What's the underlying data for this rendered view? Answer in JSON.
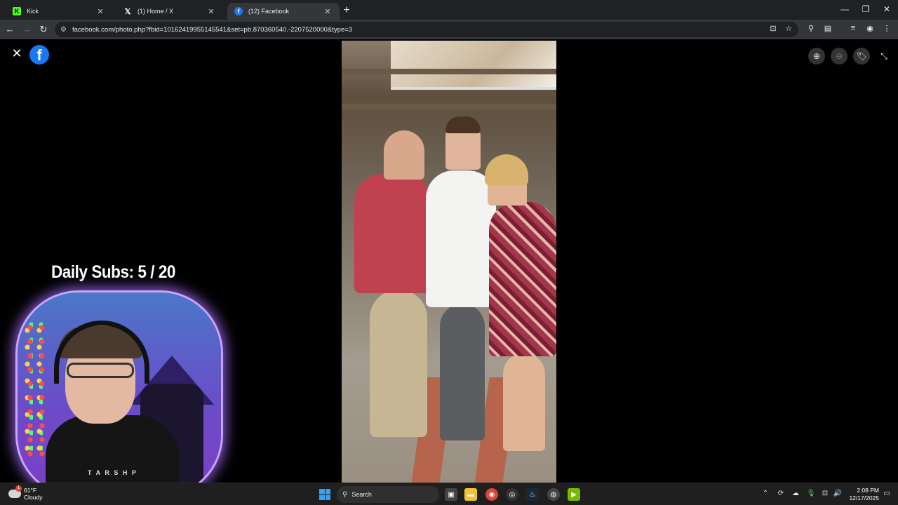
{
  "browser": {
    "tabs": [
      {
        "label": "Kick",
        "favicon": "kick-icon"
      },
      {
        "label": "(1) Home / X",
        "favicon": "x-icon"
      },
      {
        "label": "(12) Facebook",
        "favicon": "facebook-icon",
        "active": true
      }
    ],
    "url": "facebook.com/photo.php?fbid=10162419955145541&set=pb.870360540.-2207520000&type=3"
  },
  "viewer": {
    "close_glyph": "✕",
    "logo_letter": "f",
    "photo_alt": "Three people posing at a graduation ceremony"
  },
  "overlay": {
    "daily_subs": "Daily Subs:  5 / 20",
    "hoodie_text": "T A R S H  P"
  },
  "taskbar": {
    "weather_temp": "61°F",
    "weather_cond": "Cloudy",
    "search_label": "Search",
    "time": "2:08 PM",
    "date": "12/17/2025"
  },
  "colors": {
    "facebook_blue": "#1877f2",
    "kick_green": "#53fc18",
    "windows_blue": "#3aa0f3"
  }
}
